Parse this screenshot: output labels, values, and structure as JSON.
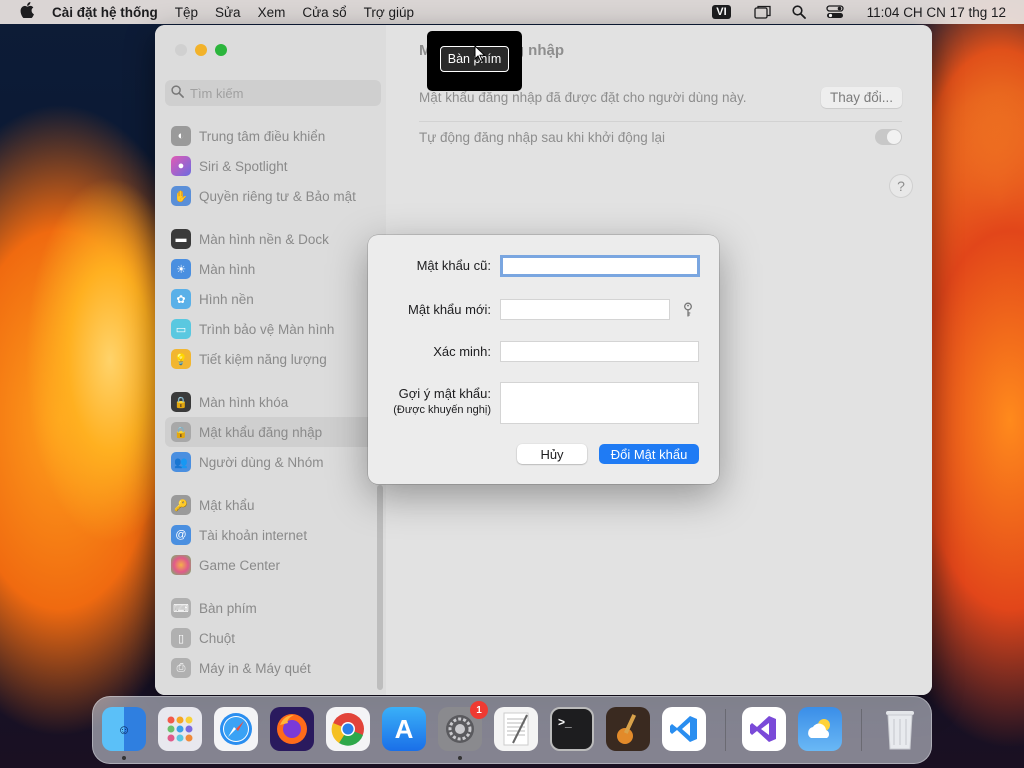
{
  "menubar": {
    "app_name": "Cài đặt hệ thống",
    "items": [
      "Tệp",
      "Sửa",
      "Xem",
      "Cửa sổ",
      "Trợ giúp"
    ],
    "input_source": "VI",
    "clock": "11:04 CH CN 17 thg 12"
  },
  "sidebar": {
    "search_placeholder": "Tìm kiếm",
    "items": [
      {
        "label": "Trung tâm điều khiển",
        "icon": "control-center-icon",
        "color": "#9a9a9a"
      },
      {
        "label": "Siri & Spotlight",
        "icon": "siri-icon",
        "color": "#b04fc9"
      },
      {
        "label": "Quyền riêng tư & Bảo mật",
        "icon": "hand-icon",
        "color": "#5a8fd8"
      },
      {
        "label": "Màn hình nền & Dock",
        "icon": "dock-icon",
        "color": "#3a3a3a"
      },
      {
        "label": "Màn hình",
        "icon": "display-icon",
        "color": "#4a8fe0"
      },
      {
        "label": "Hình nền",
        "icon": "wallpaper-icon",
        "color": "#5ab0e8"
      },
      {
        "label": "Trình bảo vệ Màn hình",
        "icon": "screensaver-icon",
        "color": "#5ac8e0"
      },
      {
        "label": "Tiết kiệm năng lượng",
        "icon": "bulb-icon",
        "color": "#f2b630"
      },
      {
        "label": "Màn hình khóa",
        "icon": "lock-icon",
        "color": "#3a3a3a"
      },
      {
        "label": "Mật khẩu đăng nhập",
        "icon": "login-lock-icon",
        "color": "#9a9a9a"
      },
      {
        "label": "Người dùng & Nhóm",
        "icon": "users-icon",
        "color": "#4a8fe0"
      },
      {
        "label": "Mật khẩu",
        "icon": "key-icon",
        "color": "#9a9a9a"
      },
      {
        "label": "Tài khoản internet",
        "icon": "at-icon",
        "color": "#4a8fe0"
      },
      {
        "label": "Game Center",
        "icon": "game-center-icon",
        "color": "#e05a8a"
      },
      {
        "label": "Bàn phím",
        "icon": "keyboard-icon",
        "color": "#9a9a9a"
      },
      {
        "label": "Chuột",
        "icon": "mouse-icon",
        "color": "#9a9a9a"
      },
      {
        "label": "Máy in & Máy quét",
        "icon": "printer-icon",
        "color": "#9a9a9a"
      }
    ]
  },
  "content": {
    "title": "Mật khẩu đăng nhập",
    "password_row_text": "Mật khẩu đăng nhập đã được đặt cho người dùng này.",
    "change_button": "Thay đổi...",
    "autologin_text": "Tự động đăng nhập sau khi khởi động lại",
    "help_label": "?"
  },
  "tooltip": {
    "text": "Bàn phím"
  },
  "dialog": {
    "old_password_label": "Mật khẩu cũ:",
    "new_password_label": "Mật khẩu mới:",
    "verify_label": "Xác minh:",
    "hint_label": "Gợi ý mật khẩu:",
    "hint_sub_label": "(Được khuyến nghị)",
    "cancel_button": "Hủy",
    "change_button": "Đổi Mật khẩu"
  },
  "dock": {
    "apps": [
      {
        "name": "Finder",
        "icon": "finder-icon",
        "running": true
      },
      {
        "name": "Launchpad",
        "icon": "launchpad-icon",
        "running": false
      },
      {
        "name": "Safari",
        "icon": "safari-icon",
        "running": false
      },
      {
        "name": "Firefox",
        "icon": "firefox-icon",
        "running": false
      },
      {
        "name": "Chrome",
        "icon": "chrome-icon",
        "running": false
      },
      {
        "name": "App Store",
        "icon": "app-store-icon",
        "running": false
      },
      {
        "name": "System Settings",
        "icon": "settings-icon",
        "running": true,
        "badge": "1"
      },
      {
        "name": "TextEdit",
        "icon": "textedit-icon",
        "running": false
      },
      {
        "name": "Terminal",
        "icon": "terminal-icon",
        "running": false
      },
      {
        "name": "GarageBand",
        "icon": "garageband-icon",
        "running": false
      },
      {
        "name": "VS Code",
        "icon": "vscode-icon",
        "running": false
      },
      {
        "name": "Visual Studio",
        "icon": "visual-studio-icon",
        "running": false
      },
      {
        "name": "Weather",
        "icon": "weather-icon",
        "running": false
      },
      {
        "name": "Trash",
        "icon": "trash-icon",
        "running": false
      }
    ]
  }
}
